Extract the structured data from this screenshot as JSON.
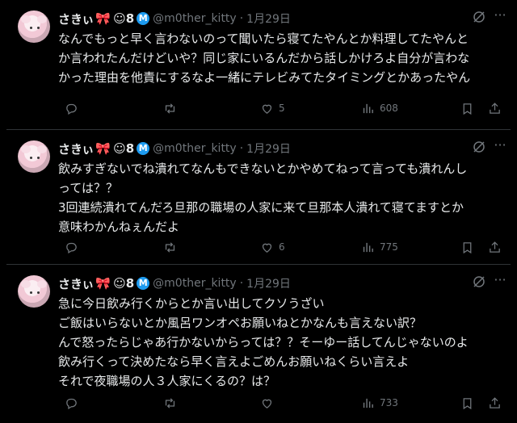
{
  "tweets": [
    {
      "name": "さきぃ",
      "suffix": "☺8",
      "badge": "M",
      "handle": "@m0ther_kitty",
      "dot": "·",
      "date": "1月29日",
      "text": "なんでもっと早く言わないのって聞いたら寝てたやんとか料理してたやんと\nか言われたんだけどいや？同じ家にいるんだから話しかけろよ自分が言わな\nかった理由を他責にするなよ一緒にテレビみてたタイミングとかあったやん",
      "likes": "5",
      "views": "608"
    },
    {
      "name": "さきぃ",
      "suffix": "☺8",
      "badge": "M",
      "handle": "@m0ther_kitty",
      "dot": "·",
      "date": "1月29日",
      "text": "飲みすぎないでね潰れてなんもできないとかやめてねって言っても潰れんし\nっては？？\n3回連続潰れてんだろ旦那の職場の人家に来て旦那本人潰れて寝てますとか\n意味わかんねぇんだよ",
      "likes": "6",
      "views": "775"
    },
    {
      "name": "さきぃ",
      "suffix": "☺8",
      "badge": "M",
      "handle": "@m0ther_kitty",
      "dot": "·",
      "date": "1月29日",
      "text": "急に今日飲み行くからとか言い出してクソうざい\nご飯はいらないとか風呂ワンオペお願いねとかなんも言えない訳？\nんで怒ったらじゃあ行かないからっては？？そーゆー話してんじゃないのよ\n飲み行くって決めたなら早く言えよごめんお願いねくらい言えよ\nそれで夜職場の人３人家にくるの？は？",
      "likes": "",
      "views": "733"
    }
  ],
  "colors": {
    "bg": "#000000",
    "text": "#e7e9ea",
    "muted": "#71767b",
    "badge": "#1d9bf0",
    "bow": "#e0245e"
  },
  "icons": [
    "reply-icon",
    "retweet-icon",
    "like-icon",
    "views-icon",
    "bookmark-icon",
    "share-icon",
    "grok-icon",
    "more-icon"
  ]
}
